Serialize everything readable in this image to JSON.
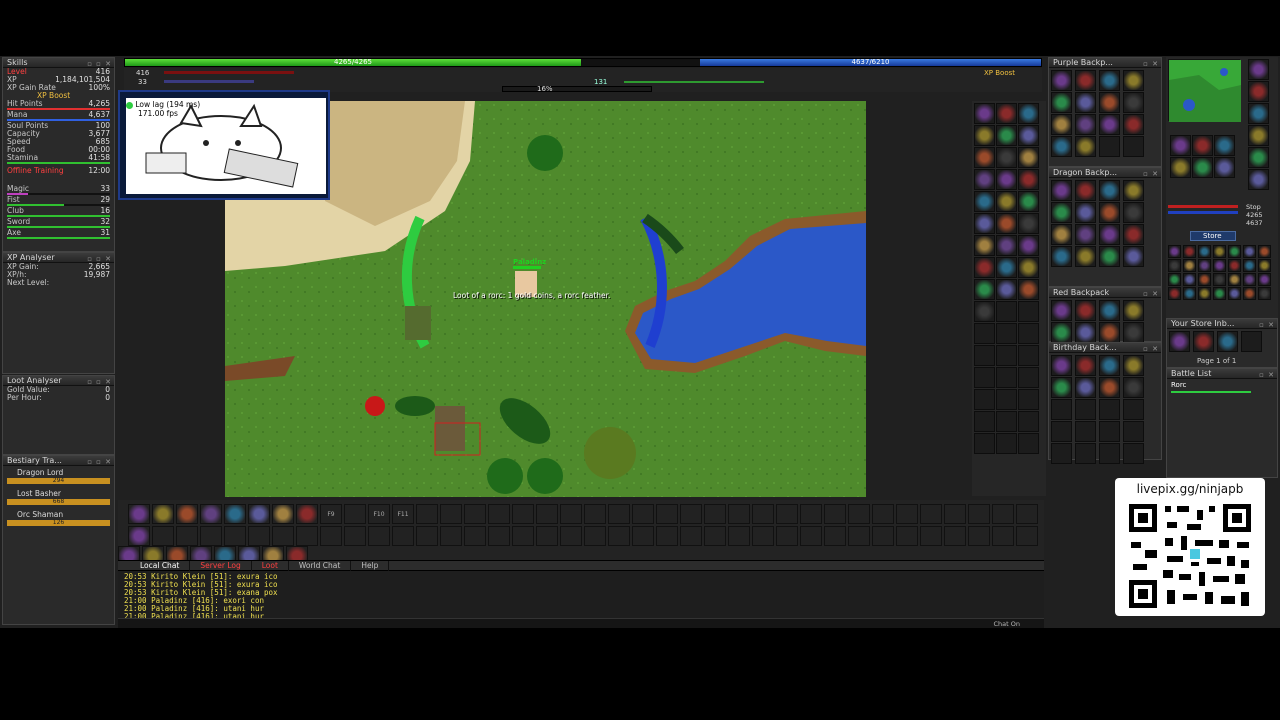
{
  "skills": {
    "title": "Skills",
    "rows": [
      {
        "label": "Level",
        "value": "416"
      },
      {
        "label": "XP",
        "value": "1,184,101,504"
      },
      {
        "label": "XP Gain Rate",
        "value": "100%"
      },
      {
        "label": "XP Boost",
        "value": ""
      },
      {
        "label": "Hit Points",
        "value": "4,265"
      },
      {
        "label": "Mana",
        "value": "4,637"
      },
      {
        "label": "Soul Points",
        "value": "100"
      },
      {
        "label": "Capacity",
        "value": "3,677"
      },
      {
        "label": "Speed",
        "value": "685"
      },
      {
        "label": "Food",
        "value": "00:00"
      },
      {
        "label": "Stamina",
        "value": "41:58"
      },
      {
        "label": "Offline Training",
        "value": "12:00"
      },
      {
        "label": "Magic",
        "value": "33"
      },
      {
        "label": "Fist",
        "value": "29"
      },
      {
        "label": "Club",
        "value": "16"
      },
      {
        "label": "Sword",
        "value": "32"
      },
      {
        "label": "Axe",
        "value": "31"
      }
    ]
  },
  "xp_analyser": {
    "title": "XP Analyser",
    "rows": [
      {
        "label": "XP Gain:",
        "value": "2,665"
      },
      {
        "label": "XP/h:",
        "value": "19,987"
      },
      {
        "label": "Next Level:",
        "value": ""
      }
    ]
  },
  "loot_analyser": {
    "title": "Loot Analyser",
    "rows": [
      {
        "label": "Gold Value:",
        "value": "0"
      },
      {
        "label": "Per Hour:",
        "value": "0"
      }
    ]
  },
  "bestiary": {
    "title": "Bestiary Tra...",
    "entries": [
      {
        "name": "Dragon Lord",
        "value": "294"
      },
      {
        "name": "Lost Basher",
        "value": "668"
      },
      {
        "name": "Orc Shaman",
        "value": "126"
      }
    ]
  },
  "top_bars": {
    "health": "4265/4265",
    "mana": "4637/6210",
    "level": "416",
    "level2": "33",
    "percent": "16%",
    "mid_value": "131",
    "xp_boost": "XP Boost"
  },
  "overlay": {
    "lag_label": "Low lag (194 ms)",
    "fps": "171.00 fps"
  },
  "game": {
    "player_name": "Paladinz",
    "loot_message": "Loot of a rorc: 1 gold coins, a rorc feather."
  },
  "containers": {
    "purple": "Purple Backp...",
    "dragon": "Dragon Backp...",
    "red": "Red Backpack",
    "birthday": "Birthday Back..."
  },
  "right_panel": {
    "stop": "Stop",
    "store": "Store",
    "store_inbox": "Your Store Inb...",
    "page": "Page 1 of 1",
    "battle_list": "Battle List",
    "battle_entry": "Rorc",
    "stat1": "4265",
    "stat2": "4637",
    "livepix": "livepix.gg/ninjapb"
  },
  "chat": {
    "tabs": [
      "Local Chat",
      "Server Log",
      "Loot",
      "World Chat",
      "Help"
    ],
    "lines": [
      "20:53 Kirito Klein [51]: exura ico",
      "20:53 Kirito Klein [51]: exura ico",
      "20:53 Kirito Klein [51]: exana pox",
      "21:00 Paladinz [416]: exori con",
      "21:00 Paladinz [416]: utani hur",
      "21:00 Paladinz [416]: utani hur"
    ],
    "chat_on": "Chat On"
  },
  "hotkeys": [
    "F9",
    "F10",
    "F11"
  ],
  "colors": {
    "health": "#2ecc40",
    "mana": "#1f5fd0",
    "grass": "#4e8a2a",
    "water": "#2b58c8",
    "sand": "#e0cfa0",
    "chat": "#f0e050"
  }
}
